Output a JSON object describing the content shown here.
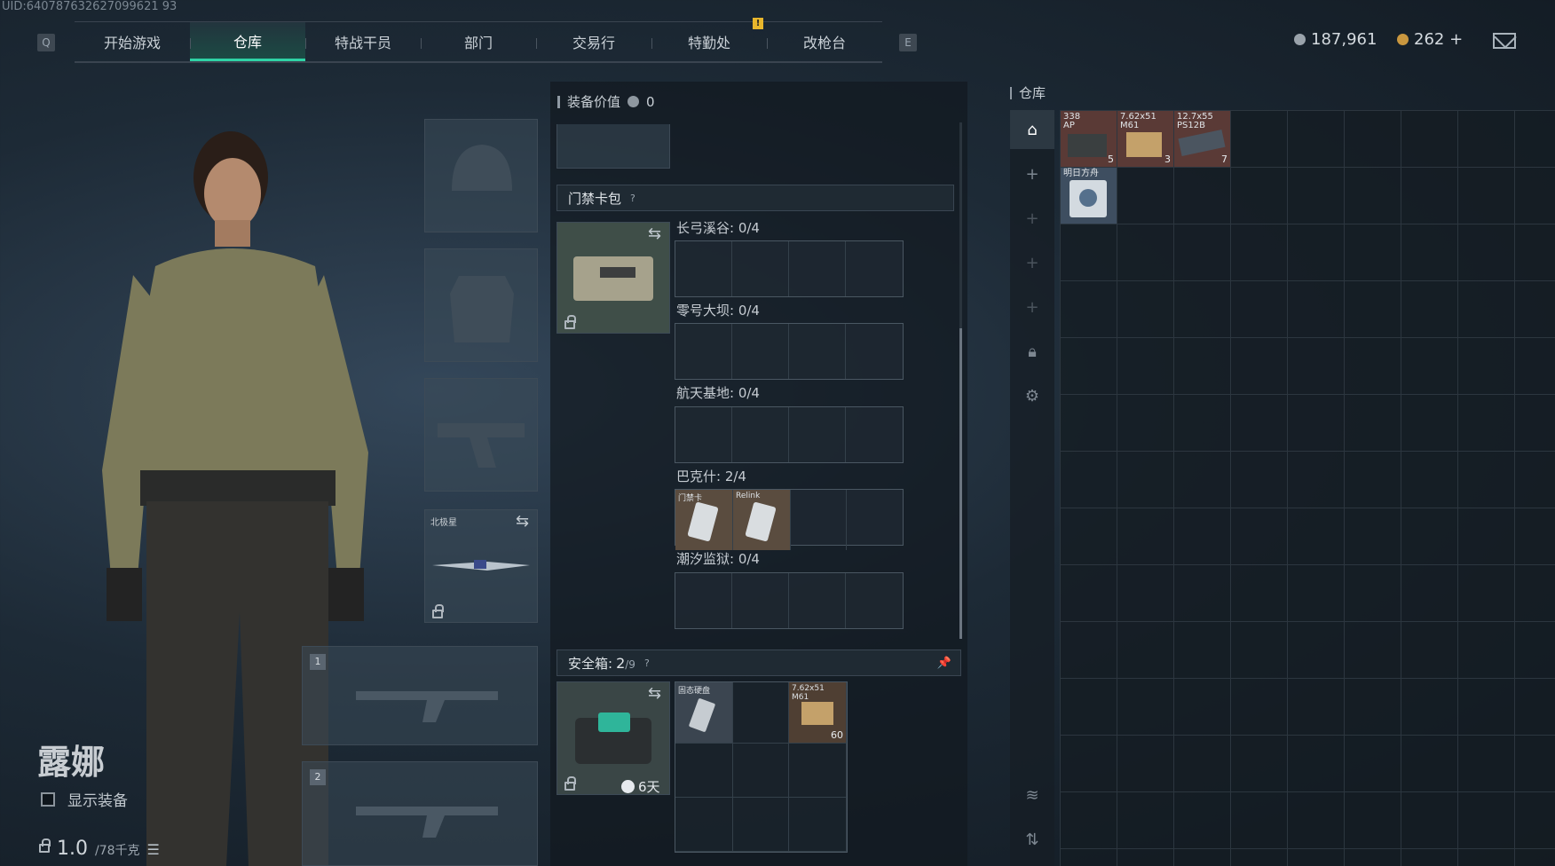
{
  "uid": "UID:640787632627099621 93",
  "nav": {
    "left_key": "Q",
    "right_key": "E",
    "tabs": [
      "开始游戏",
      "仓库",
      "特战干员",
      "部门",
      "交易行",
      "特勤处",
      "改枪台"
    ],
    "active": "仓库",
    "notice": "!"
  },
  "currency": {
    "silver": "187,961",
    "gold": "262 +"
  },
  "operator": {
    "name": "露娜",
    "show_equipment_label": "显示装备",
    "weight": "1.0",
    "weight_max": "/78千克"
  },
  "equipment": {
    "melee_label": "北极星",
    "weapon_slot_1": "1",
    "weapon_slot_2": "2"
  },
  "loadout": {
    "header_label": "装备价值",
    "header_value": "0",
    "keycard_pack": {
      "label": "门禁卡包",
      "help": "?",
      "maps": [
        {
          "name": "长弓溪谷: 0/4"
        },
        {
          "name": "零号大坝: 0/4"
        },
        {
          "name": "航天基地: 0/4"
        },
        {
          "name": "巴克什: 2/4",
          "cards": [
            "门禁卡",
            "Relink"
          ]
        },
        {
          "name": "潮汐监狱: 0/4"
        }
      ]
    },
    "safe_box": {
      "label": "安全箱:",
      "count": "2",
      "capacity": "/9",
      "help": "?",
      "time_left": "6天",
      "items": [
        {
          "label": "固态硬盘",
          "count": ""
        },
        {
          "label": "7.62x51\nM61",
          "count": "60"
        }
      ]
    }
  },
  "warehouse": {
    "label": "仓库",
    "items": [
      {
        "label": "338\nAP",
        "count": "5",
        "color": "#5a3a36"
      },
      {
        "label": "7.62x51\nM61",
        "count": "3",
        "color": "#5a3a36"
      },
      {
        "label": "12.7x55\nPS12B",
        "count": "7",
        "color": "#5a3a36"
      },
      {
        "label": "明日方舟",
        "count": "",
        "color": "#3e4e60"
      }
    ]
  }
}
